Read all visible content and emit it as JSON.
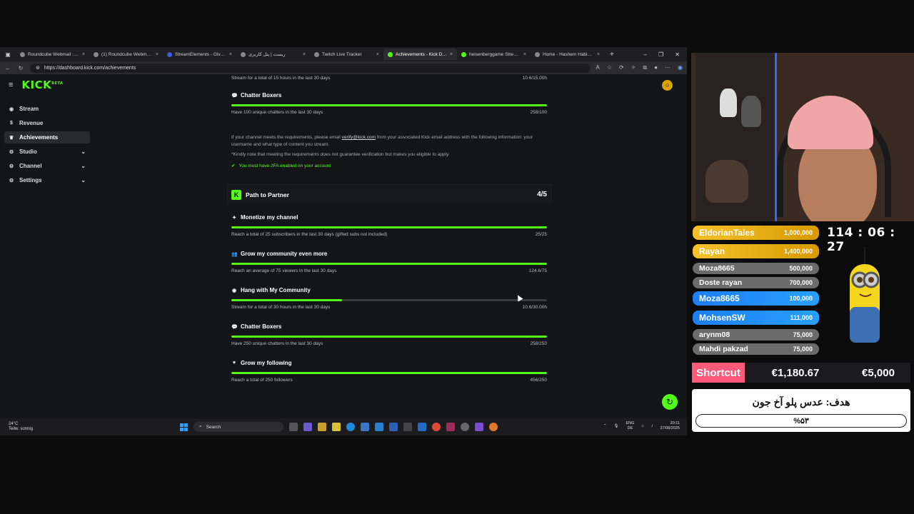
{
  "browser": {
    "tabs": [
      {
        "title": "Roundcube Webmail :: Inbo",
        "icon": "roundcube-icon"
      },
      {
        "title": "(1) Roundcube Webmail :: I",
        "icon": "roundcube-icon"
      },
      {
        "title": "StreamElements - Giveaway",
        "icon": "streamelements-icon"
      },
      {
        "title": "ریست | پنل کاربری",
        "icon": "globe-icon"
      },
      {
        "title": "Twitch Live Tracker",
        "icon": "globe-icon"
      },
      {
        "title": "Achievements - Kick Dashb",
        "icon": "kick-icon",
        "active": true
      },
      {
        "title": "heisenberggame Stream - Y",
        "icon": "kick-icon"
      },
      {
        "title": "Home - Hashem Habibian",
        "icon": "globe-icon"
      }
    ],
    "url": "https://dashboard.kick.com/achievements"
  },
  "kick": {
    "logo": "KICK",
    "logo_badge": "BETA",
    "sidebar": [
      {
        "label": "Stream",
        "icon": "broadcast-icon"
      },
      {
        "label": "Revenue",
        "icon": "dollar-icon"
      },
      {
        "label": "Achievements",
        "icon": "trophy-icon",
        "active": true
      },
      {
        "label": "Studio",
        "icon": "gear-icon",
        "chevron": true
      },
      {
        "label": "Channel",
        "icon": "channel-icon",
        "chevron": true
      },
      {
        "label": "Settings",
        "icon": "settings-icon",
        "chevron": true
      }
    ],
    "verification": {
      "top_item": {
        "desc": "Stream for a total of 15 hours in the last 30 days",
        "progress": "10.6/15.00h",
        "fraction": 0.7
      },
      "chatter": {
        "title": "Chatter Boxers",
        "desc": "Have 100 unique chatters in the last 30 days",
        "progress": "258/100",
        "fraction": 1.0
      },
      "note_prefix": "If your channel meets the requirements, please email ",
      "note_email": "verify@kick.com",
      "note_suffix": " from your associated Kick email address with the following information: your username and what type of content you stream.",
      "note2": "*Kindly note that meeting the requirements does not guarantee verification but makes you eligible to apply.",
      "twofa": "You must have 2FA enabled on your account"
    },
    "partner": {
      "title": "Path to Partner",
      "progress": "4/5",
      "items": [
        {
          "title": "Monetize my channel",
          "icon": "sparkle-icon",
          "desc": "Reach a total of 25 subscribers in the last 30 days (gifted subs not included)",
          "progress": "25/25",
          "fraction": 1.0
        },
        {
          "title": "Grow my community even more",
          "icon": "users-icon",
          "desc": "Reach an average of 75 viewers in the last 30 days",
          "progress": "124.6/75",
          "fraction": 1.0
        },
        {
          "title": "Hang with My Community",
          "icon": "broadcast-icon",
          "desc": "Stream for a total of 30 hours in the last 30 days",
          "progress": "10.6/30.00h",
          "fraction": 0.35
        },
        {
          "title": "Chatter Boxers",
          "icon": "chat-icon",
          "desc": "Have 250 unique chatters in the last 30 days",
          "progress": "258/250",
          "fraction": 1.0
        },
        {
          "title": "Grow my following",
          "icon": "heart-icon",
          "desc": "Reach a total of 250 followers",
          "progress": "456/250",
          "fraction": 1.0
        }
      ]
    }
  },
  "taskbar": {
    "weather_temp": "24°C",
    "weather_desc": "Teilw. sonnig",
    "search": "Search",
    "lang1": "ENG",
    "lang2": "DE",
    "time": "20:11",
    "date": "27/08/2025"
  },
  "overlay": {
    "donors": [
      {
        "name": "EldorianTales",
        "amount": "1,000,000",
        "style": "gold"
      },
      {
        "name": "Rayan",
        "amount": "1,400,000",
        "style": "gold"
      },
      {
        "name": "Moza8665",
        "amount": "500,000",
        "style": "grey"
      },
      {
        "name": "Doste rayan",
        "amount": "700,000",
        "style": "grey"
      },
      {
        "name": "Moza8665",
        "amount": "100,000",
        "style": "blue"
      },
      {
        "name": "MohsenSW",
        "amount": "111,000",
        "style": "blue"
      },
      {
        "name": "arynm08",
        "amount": "75,000",
        "style": "grey"
      },
      {
        "name": "Mahdi pakzad",
        "amount": "75,000",
        "style": "grey"
      }
    ],
    "timer": "114 : 06 : 27",
    "shortcut_label": "Shortcut",
    "shortcut_current": "€1,180.67",
    "shortcut_goal": "€5,000",
    "goal_title": "هدف: عدس پلو آخ جون",
    "goal_percent_label": "%۵۳",
    "goal_fraction": 0.53
  }
}
